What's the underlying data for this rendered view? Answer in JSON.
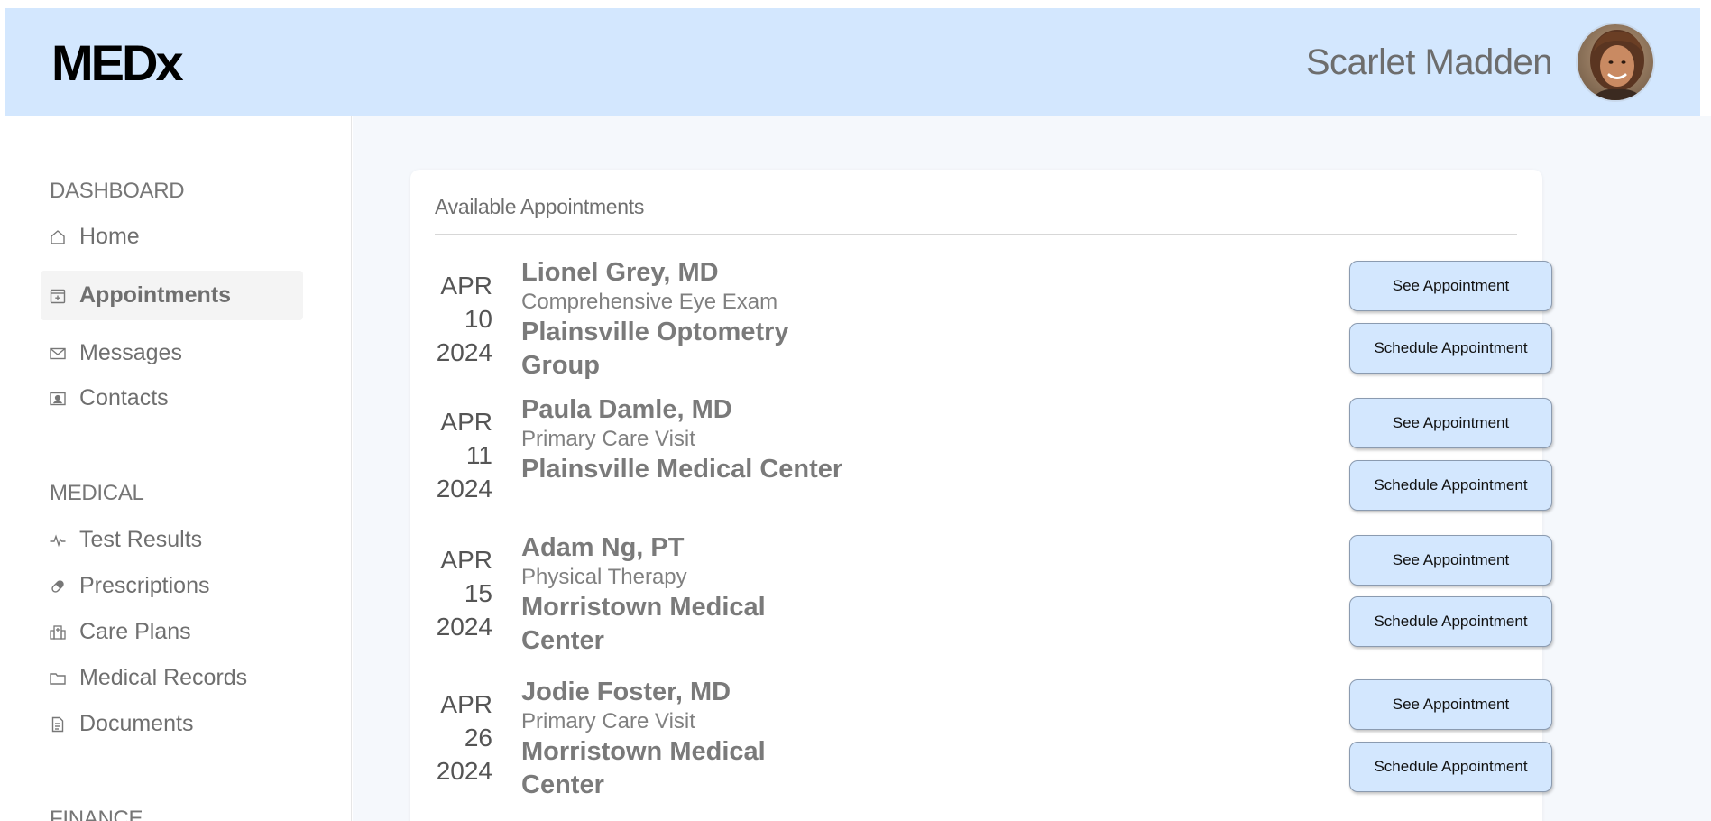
{
  "header": {
    "logo": "MEDx",
    "user_name": "Scarlet Madden",
    "avatar_alt": "user-avatar"
  },
  "sidebar": {
    "sections": [
      {
        "title": "DASHBOARD",
        "items": [
          {
            "label": "Home",
            "icon": "home-icon"
          },
          {
            "label": "Appointments",
            "icon": "calendar-plus-icon",
            "active": true
          },
          {
            "label": "Messages",
            "icon": "envelope-icon"
          },
          {
            "label": "Contacts",
            "icon": "contact-card-icon"
          }
        ]
      },
      {
        "title": "MEDICAL",
        "items": [
          {
            "label": "Test Results",
            "icon": "pulse-icon"
          },
          {
            "label": "Prescriptions",
            "icon": "pill-icon"
          },
          {
            "label": "Care Plans",
            "icon": "hospital-icon"
          },
          {
            "label": "Medical Records",
            "icon": "folder-icon"
          },
          {
            "label": "Documents",
            "icon": "document-icon"
          }
        ]
      },
      {
        "title": "FINANCE",
        "items": []
      }
    ]
  },
  "main": {
    "card_title": "Available Appointments",
    "appointments": [
      {
        "month": "APR",
        "day": "10",
        "year": "2024",
        "doctor": "Lionel Grey, MD",
        "visit": "Comprehensive Eye Exam",
        "location": "Plainsville Optometry Group"
      },
      {
        "month": "APR",
        "day": "11",
        "year": "2024",
        "doctor": "Paula Damle, MD",
        "visit": "Primary Care Visit",
        "location": "Plainsville Medical Center"
      },
      {
        "month": "APR",
        "day": "15",
        "year": "2024",
        "doctor": "Adam Ng, PT",
        "visit": "Physical Therapy",
        "location": "Morristown Medical Center"
      },
      {
        "month": "APR",
        "day": "26",
        "year": "2024",
        "doctor": "Jodie Foster, MD",
        "visit": "Primary Care Visit",
        "location": "Morristown Medical Center"
      }
    ],
    "see_label": "See Appointment",
    "schedule_label": "Schedule Appointment"
  },
  "colors": {
    "header_bg": "#d3e7fe",
    "button_bg": "#d3e7fe",
    "main_bg": "#f5f8fc"
  }
}
